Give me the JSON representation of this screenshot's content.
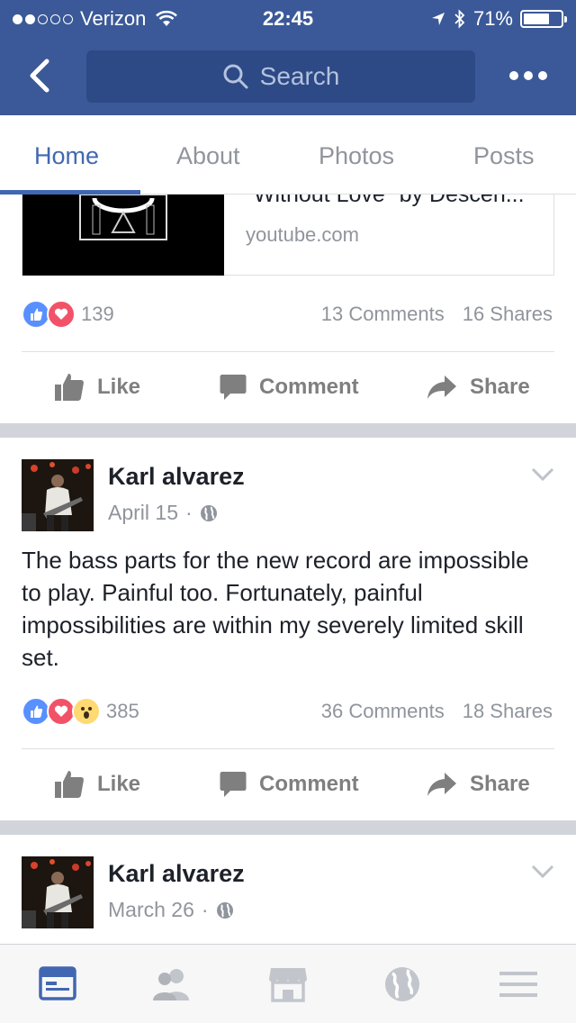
{
  "status_bar": {
    "carrier": "Verizon",
    "time": "22:45",
    "battery": "71%",
    "battery_level": 0.71,
    "signal_bars_filled": 2,
    "signal_bars_total": 5
  },
  "nav": {
    "search_placeholder": "Search"
  },
  "tabs": [
    {
      "label": "Home",
      "active": true
    },
    {
      "label": "About",
      "active": false
    },
    {
      "label": "Photos",
      "active": false
    },
    {
      "label": "Posts",
      "active": false
    }
  ],
  "link_preview": {
    "title_partial": "\"Without Love\" by Descen...",
    "domain": "youtube.com"
  },
  "posts": [
    {
      "reaction_count": "139",
      "comments": "13 Comments",
      "shares": "16 Shares",
      "reactions": [
        "like",
        "love"
      ]
    },
    {
      "author": "Karl alvarez",
      "date": "April 15",
      "text": "The bass parts for the new record are impossible to play. Painful too. Fortunately, painful impossibilities are within my severely limited skill set.",
      "reaction_count": "385",
      "comments": "36 Comments",
      "shares": "18 Shares",
      "reactions": [
        "like",
        "love",
        "wow"
      ]
    },
    {
      "author": "Karl alvarez",
      "date": "March 26"
    }
  ],
  "actions": {
    "like": "Like",
    "comment": "Comment",
    "share": "Share"
  },
  "bottom_nav": [
    "news-feed-icon",
    "friends-icon",
    "marketplace-icon",
    "globe-icon",
    "menu-icon"
  ],
  "colors": {
    "brand_blue": "#3b5998",
    "active_tab": "#4267b2",
    "like": "#5890ff",
    "love": "#f25268",
    "wow": "#ffd972"
  }
}
